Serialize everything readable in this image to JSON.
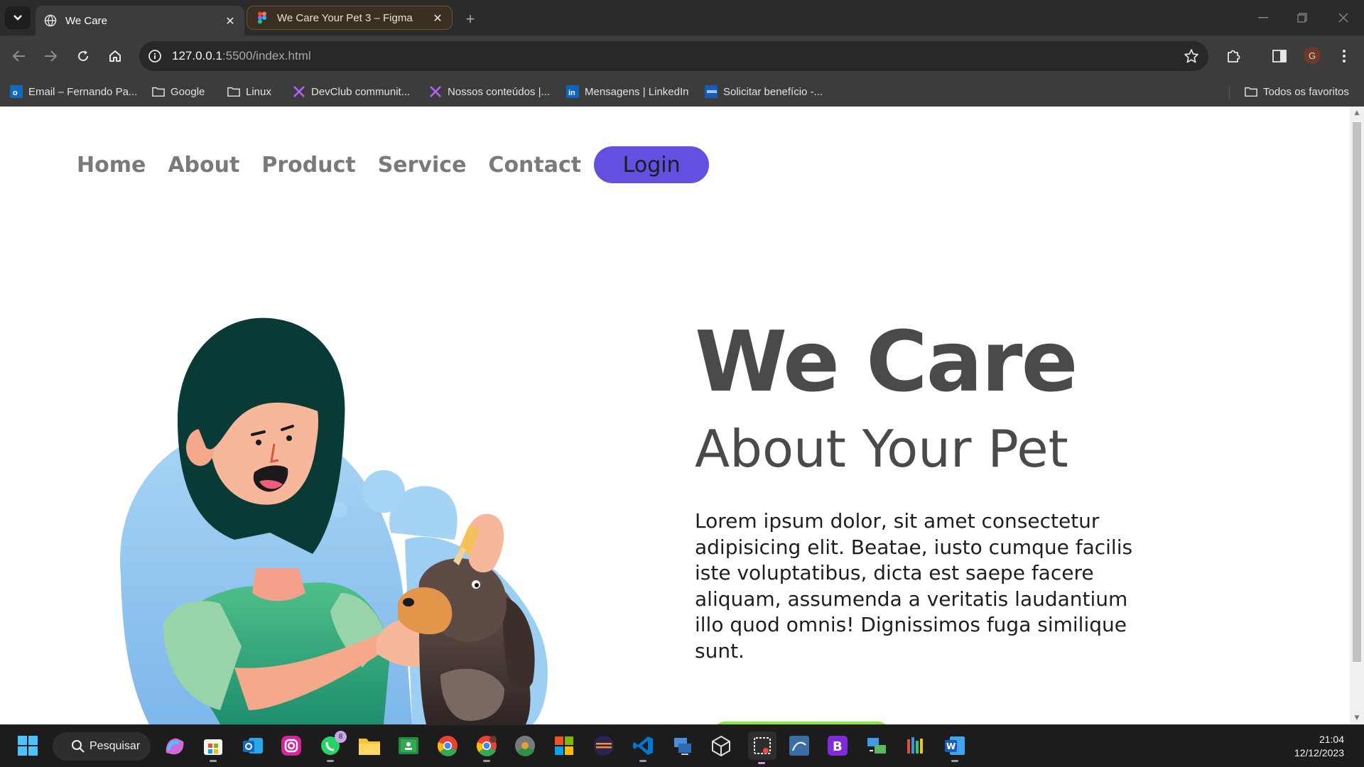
{
  "browser": {
    "tabs": [
      {
        "title": "We Care",
        "active": true
      },
      {
        "title": "We Care Your Pet 3 – Figma",
        "active": false
      }
    ],
    "address": {
      "host": "127.0.0.1",
      "path": ":5500/index.html"
    },
    "profile_initial": "G",
    "bookmarks": [
      {
        "label": "Email – Fernando Pa...",
        "icon": "outlook-icon"
      },
      {
        "label": "Google",
        "icon": "folder-icon"
      },
      {
        "label": "Linux",
        "icon": "folder-icon"
      },
      {
        "label": "DevClub communit...",
        "icon": "devclub-icon"
      },
      {
        "label": "Nossos conteúdos |...",
        "icon": "devclub-icon"
      },
      {
        "label": "Mensagens | LinkedIn",
        "icon": "linkedin-icon"
      },
      {
        "label": "Solicitar benefício -...",
        "icon": "inss-icon"
      }
    ],
    "all_bookmarks": "Todos os favoritos"
  },
  "page": {
    "nav": [
      "Home",
      "About",
      "Product",
      "Service",
      "Contact"
    ],
    "login_label": "Login",
    "hero": {
      "title": "We Care",
      "subtitle": "About Your Pet",
      "text": "Lorem ipsum dolor, sit amet consectetur adipisicing elit. Beatae, iusto cumque facilis iste voluptatibus, dicta est saepe facere aliquam, assumenda a veritatis laudantium illo quod omnis! Dignissimos fuga similique sunt."
    },
    "colors": {
      "accent": "#6251e0",
      "text": "#4a4a4a",
      "cta": "#8ee44a"
    }
  },
  "taskbar": {
    "search_label": "Pesquisar",
    "whatsapp_badge": "8",
    "time": "21:04",
    "date": "12/12/2023"
  }
}
